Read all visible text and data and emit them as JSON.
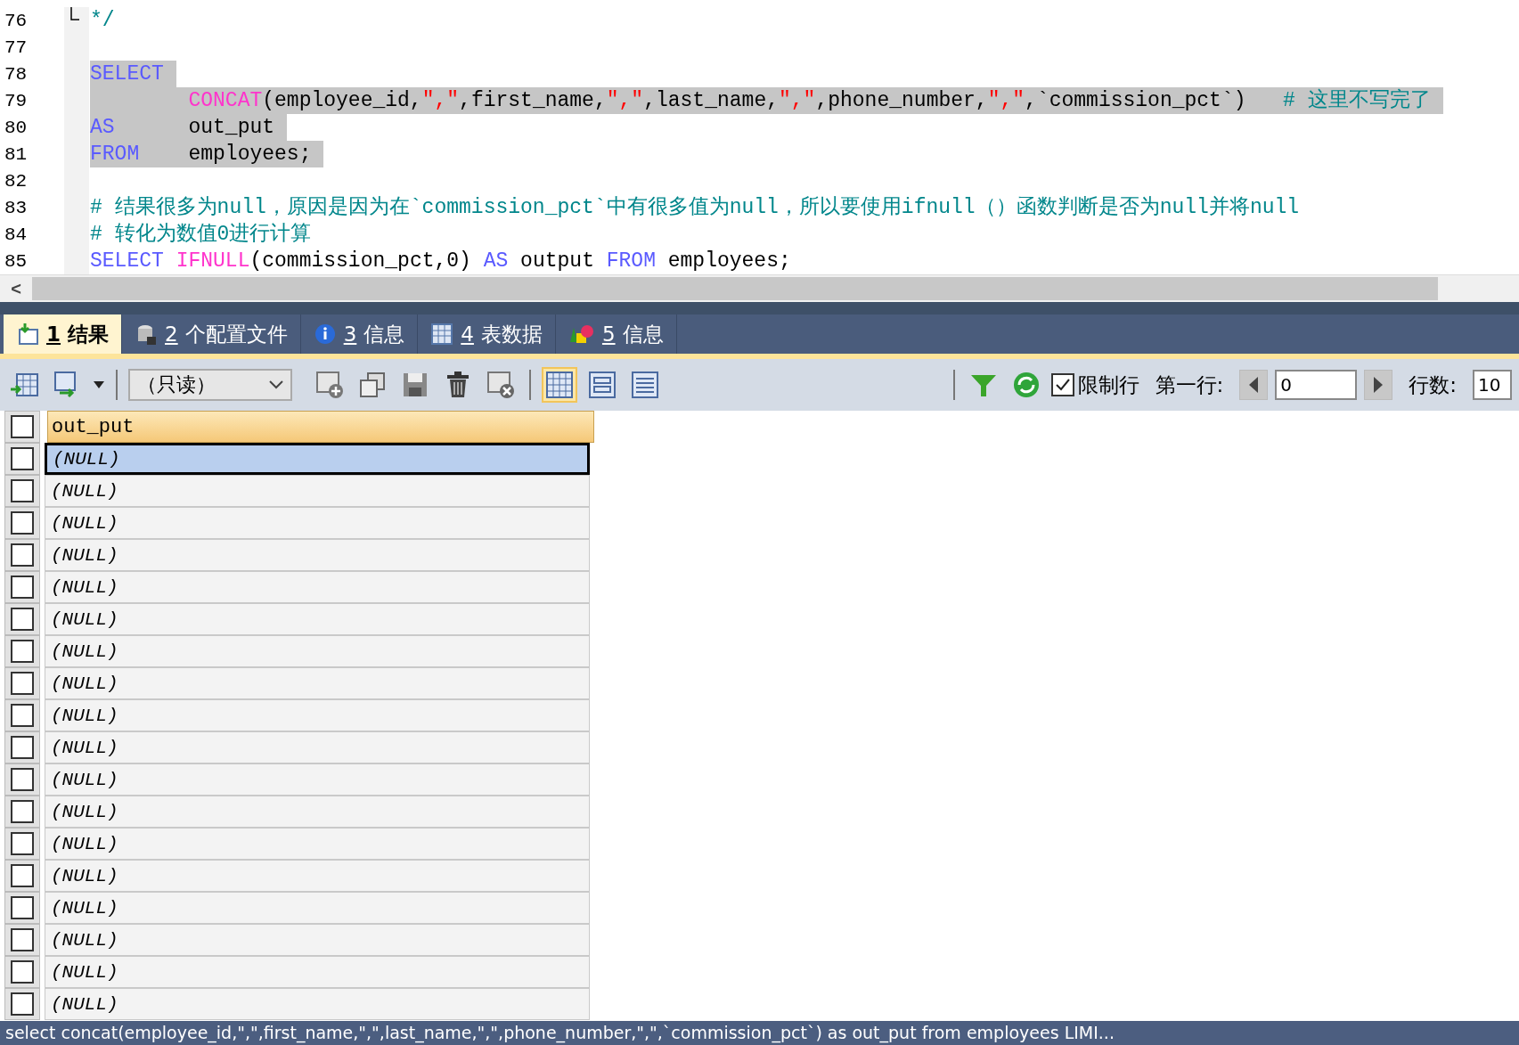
{
  "editor": {
    "lines": [
      {
        "number": "76",
        "fold": true,
        "selected": false,
        "tokens": [
          {
            "kind": "comment",
            "text": "*/"
          }
        ]
      },
      {
        "number": "77",
        "fold": false,
        "selected": false
      },
      {
        "number": "78",
        "fold": false,
        "selected": true,
        "tokens": [
          {
            "kind": "keyword",
            "text": "SELECT"
          }
        ]
      },
      {
        "number": "79",
        "fold": false,
        "selected": true,
        "tokens": [
          {
            "kind": "function",
            "text": "        CONCAT"
          },
          {
            "kind": "plain",
            "text": "(employee_id,"
          },
          {
            "kind": "string",
            "text": "\",\""
          },
          {
            "kind": "plain",
            "text": ",first_name,"
          },
          {
            "kind": "string",
            "text": "\",\""
          },
          {
            "kind": "plain",
            "text": ",last_name,"
          },
          {
            "kind": "string",
            "text": "\",\""
          },
          {
            "kind": "plain",
            "text": ",phone_number,"
          },
          {
            "kind": "string",
            "text": "\",\""
          },
          {
            "kind": "plain",
            "text": ",`commission_pct`)   "
          },
          {
            "kind": "comment",
            "text": "# 这里不写完了"
          }
        ]
      },
      {
        "number": "80",
        "fold": false,
        "selected": true,
        "tokens": [
          {
            "kind": "keyword",
            "text": "AS"
          },
          {
            "kind": "plain",
            "text": "      out_put"
          }
        ]
      },
      {
        "number": "81",
        "fold": false,
        "selected": true,
        "tokens": [
          {
            "kind": "keyword",
            "text": "FROM"
          },
          {
            "kind": "plain",
            "text": "    employees;"
          }
        ]
      },
      {
        "number": "82",
        "fold": false,
        "selected": false
      },
      {
        "number": "83",
        "fold": false,
        "selected": false,
        "tokens": [
          {
            "kind": "comment",
            "text": "# 结果很多为null，原因是因为在`commission_pct`中有很多值为null，所以要使用ifnull（）函数判断是否为null并将null"
          }
        ]
      },
      {
        "number": "84",
        "fold": false,
        "selected": false,
        "tokens": [
          {
            "kind": "comment",
            "text": "# 转化为数值0进行计算"
          }
        ]
      },
      {
        "number": "85",
        "fold": false,
        "selected": false,
        "tokens": [
          {
            "kind": "keyword",
            "text": "SELECT"
          },
          {
            "kind": "function",
            "text": " IFNULL"
          },
          {
            "kind": "plain",
            "text": "(commission_pct,0) "
          },
          {
            "kind": "keyword",
            "text": "AS"
          },
          {
            "kind": "plain",
            "text": " output "
          },
          {
            "kind": "keyword",
            "text": "FROM"
          },
          {
            "kind": "plain",
            "text": " employees;"
          }
        ]
      }
    ],
    "scroll_left": "<"
  },
  "tabs": [
    {
      "number": "1",
      "label": "结果",
      "selected": true
    },
    {
      "number": "2",
      "label": "个配置文件",
      "selected": false
    },
    {
      "number": "3",
      "label": "信息",
      "selected": false
    },
    {
      "number": "4",
      "label": "表数据",
      "selected": false
    },
    {
      "number": "5",
      "label": "信息",
      "selected": false
    }
  ],
  "toolbar": {
    "mode": "（只读）",
    "views": [
      {
        "kind": "grid",
        "selected": true
      },
      {
        "kind": "form",
        "selected": false
      },
      {
        "kind": "text",
        "selected": false
      }
    ],
    "limit_rows": {
      "label": "限制行",
      "checked": true
    },
    "first_row_label": "第一行:",
    "first_row": "0",
    "row_count_label": "行数:",
    "row_count": "10"
  },
  "grid": {
    "columns": [
      "out_put"
    ],
    "select_all_checked": false,
    "rows": [
      {
        "value": "(NULL)",
        "selected": true,
        "checked": false
      },
      {
        "value": "(NULL)",
        "selected": false,
        "checked": false
      },
      {
        "value": "(NULL)",
        "selected": false,
        "checked": false
      },
      {
        "value": "(NULL)",
        "selected": false,
        "checked": false
      },
      {
        "value": "(NULL)",
        "selected": false,
        "checked": false
      },
      {
        "value": "(NULL)",
        "selected": false,
        "checked": false
      },
      {
        "value": "(NULL)",
        "selected": false,
        "checked": false
      },
      {
        "value": "(NULL)",
        "selected": false,
        "checked": false
      },
      {
        "value": "(NULL)",
        "selected": false,
        "checked": false
      },
      {
        "value": "(NULL)",
        "selected": false,
        "checked": false
      },
      {
        "value": "(NULL)",
        "selected": false,
        "checked": false
      },
      {
        "value": "(NULL)",
        "selected": false,
        "checked": false
      },
      {
        "value": "(NULL)",
        "selected": false,
        "checked": false
      },
      {
        "value": "(NULL)",
        "selected": false,
        "checked": false
      },
      {
        "value": "(NULL)",
        "selected": false,
        "checked": false
      },
      {
        "value": "(NULL)",
        "selected": false,
        "checked": false
      },
      {
        "value": "(NULL)",
        "selected": false,
        "checked": false
      },
      {
        "value": "(NULL)",
        "selected": false,
        "checked": false
      }
    ]
  },
  "status_bar": "select concat(employee_id,\",\",first_name,\",\",last_name,\",\",phone_number,\",\",`commission_pct`) as out_put from employees LIMI..."
}
